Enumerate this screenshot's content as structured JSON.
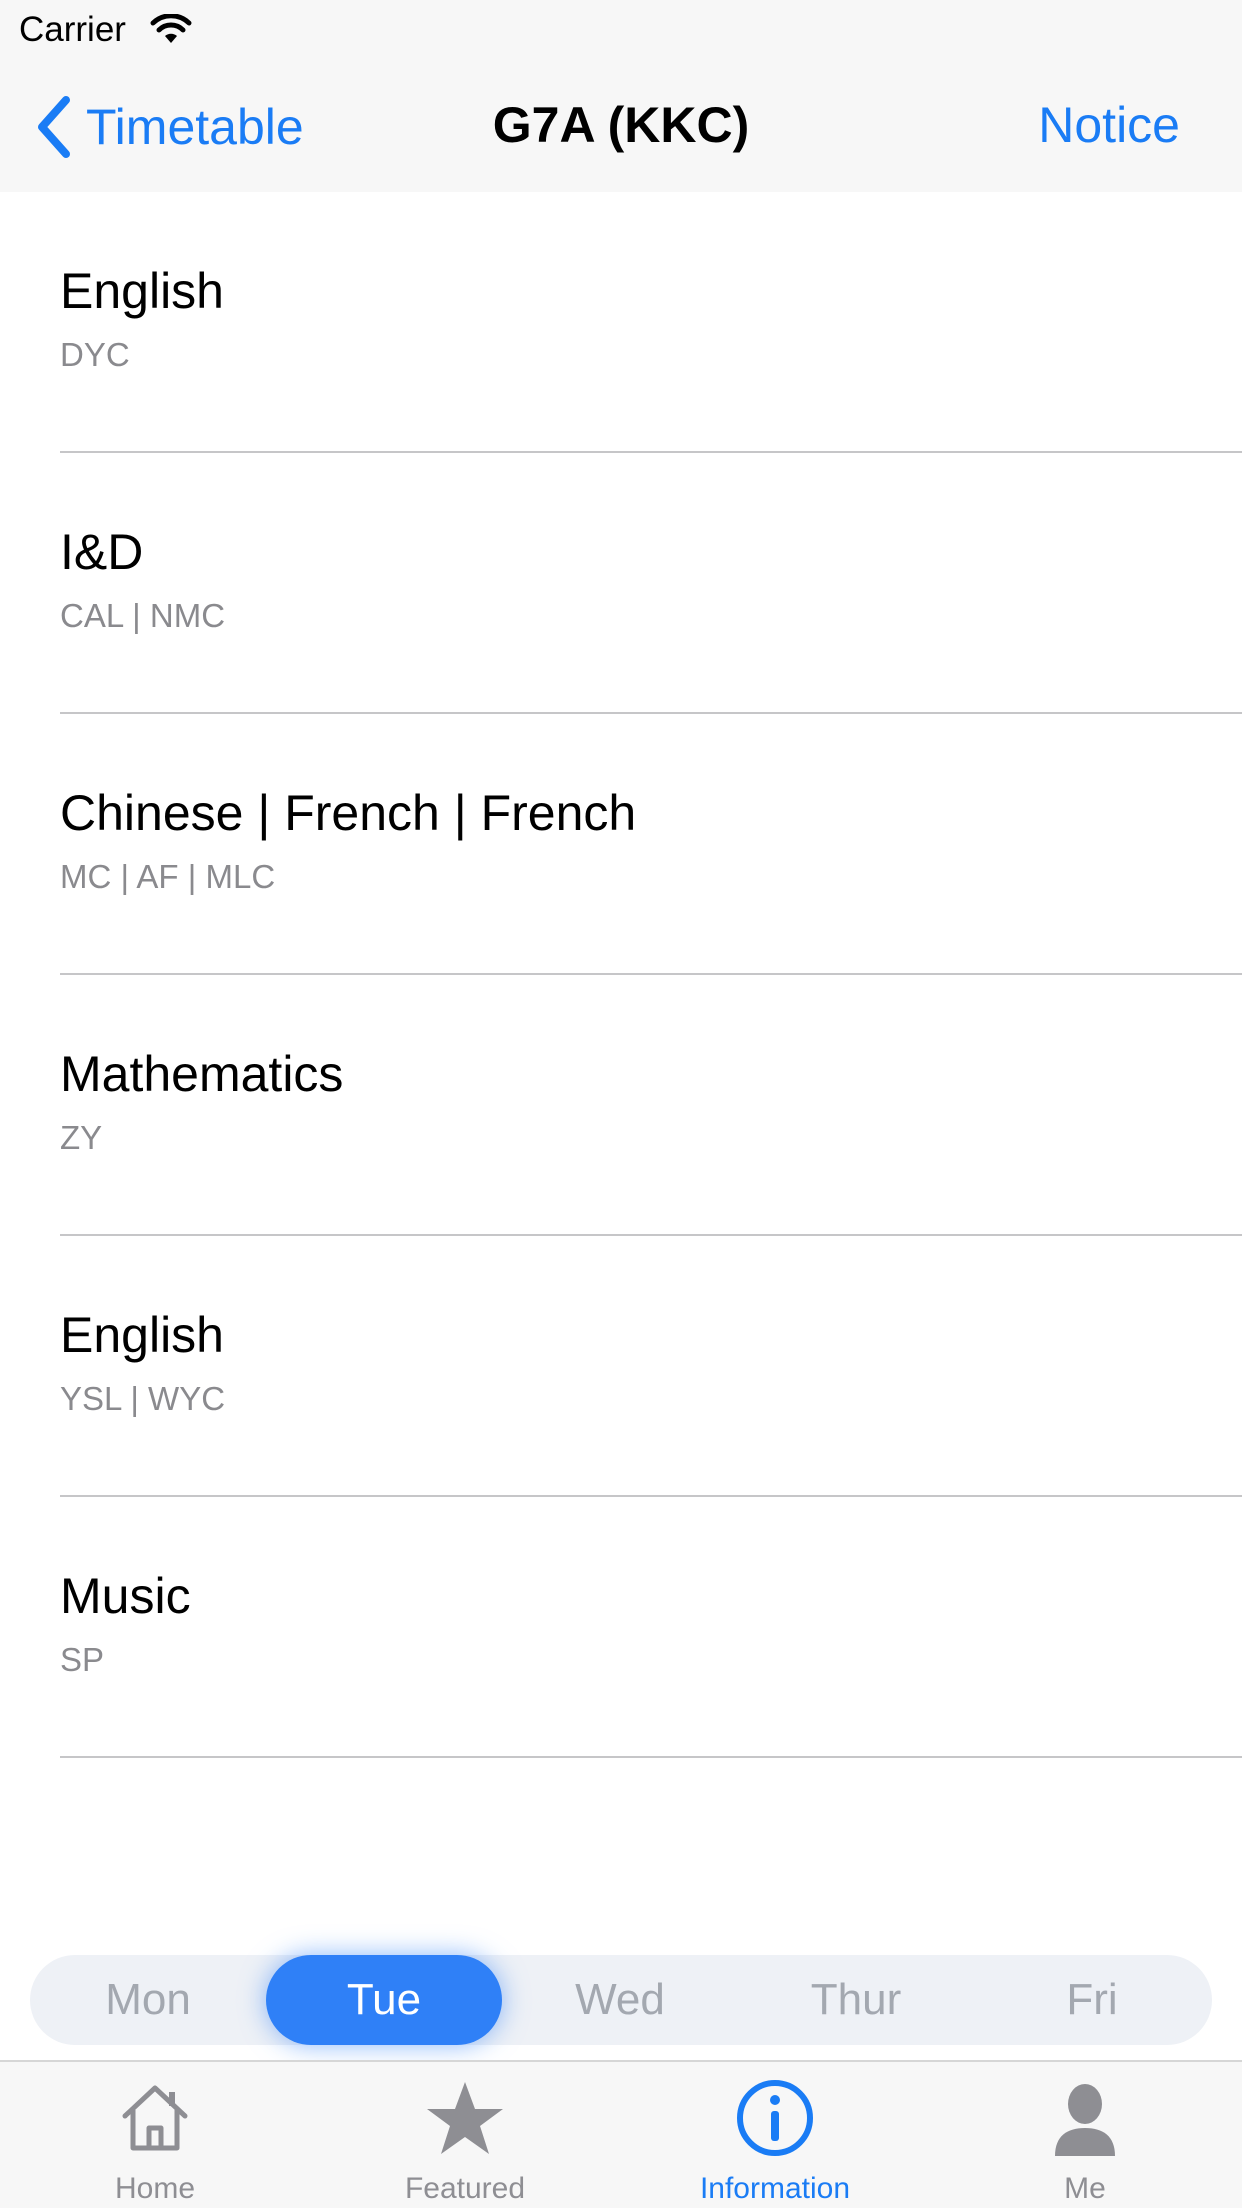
{
  "status_bar": {
    "carrier": "Carrier"
  },
  "nav": {
    "back_label": "Timetable",
    "title": "G7A (KKC)",
    "right_label": "Notice"
  },
  "lessons": [
    {
      "title": "English",
      "subtitle": "DYC"
    },
    {
      "title": "I&D",
      "subtitle": "CAL | NMC"
    },
    {
      "title": "Chinese | French | French",
      "subtitle": "MC | AF | MLC"
    },
    {
      "title": "Mathematics",
      "subtitle": "ZY"
    },
    {
      "title": "English",
      "subtitle": "YSL | WYC"
    },
    {
      "title": "Music",
      "subtitle": "SP"
    }
  ],
  "days": {
    "selected": "Tue",
    "items": [
      "Mon",
      "Tue",
      "Wed",
      "Thur",
      "Fri"
    ]
  },
  "tab_bar": {
    "selected": "Information",
    "items": [
      {
        "label": "Home",
        "icon": "house-icon"
      },
      {
        "label": "Featured",
        "icon": "star-icon"
      },
      {
        "label": "Information",
        "icon": "info-icon"
      },
      {
        "label": "Me",
        "icon": "person-icon"
      }
    ]
  },
  "colors": {
    "accent": "#1a7cf5",
    "selected_day": "#2f80f7",
    "secondary_text": "#8a8a8e",
    "inactive_tab": "#8e8e93"
  }
}
